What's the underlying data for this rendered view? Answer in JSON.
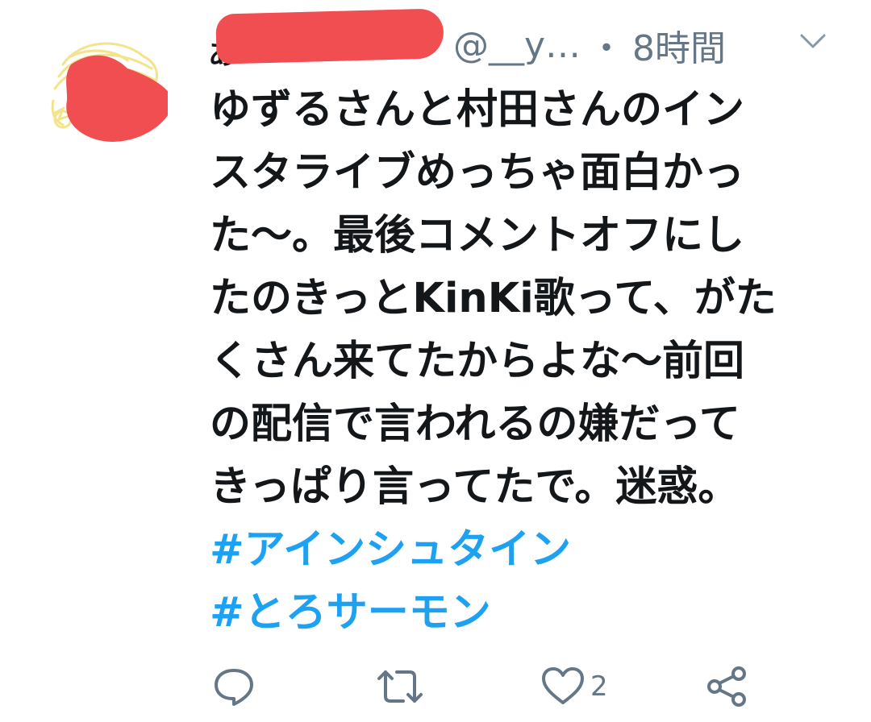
{
  "tweet": {
    "author_name_visible": "あ",
    "handle": "@__y…",
    "separator": "・",
    "time": "8時間",
    "text_lines": [
      "ゆずるさんと村田さんのイン",
      "スタライブめっちゃ面白かっ",
      "た〜。最後コメントオフにし",
      "たのきっとKinKi歌って、がた",
      "くさん来てたからよな〜前回",
      "の配信で言われるの嫌だって",
      "きっぱり言ってたで。迷惑。"
    ],
    "hashtags": [
      "#アインシュタイン",
      "#とろサーモン"
    ],
    "actions": {
      "reply_icon": "reply-icon",
      "retweet_icon": "retweet-icon",
      "like_icon": "heart-icon",
      "like_count": "2",
      "share_icon": "share-icon"
    }
  },
  "colors": {
    "text": "#14171a",
    "secondary": "#657786",
    "hashtag": "#1da1f2",
    "redaction": "#f04e50"
  }
}
